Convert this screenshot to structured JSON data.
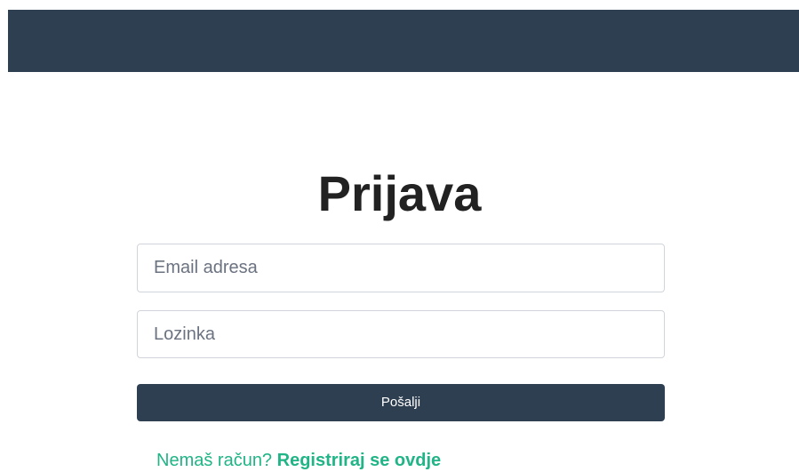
{
  "header": {
    "background_color": "#2f3f52"
  },
  "form": {
    "title": "Prijava",
    "email_placeholder": "Email adresa",
    "password_placeholder": "Lozinka",
    "submit_label": "Pošalji"
  },
  "footer": {
    "prompt": "Nemaš račun? ",
    "register_link": "Registriraj se ovdje",
    "accent_color": "#20b486"
  }
}
